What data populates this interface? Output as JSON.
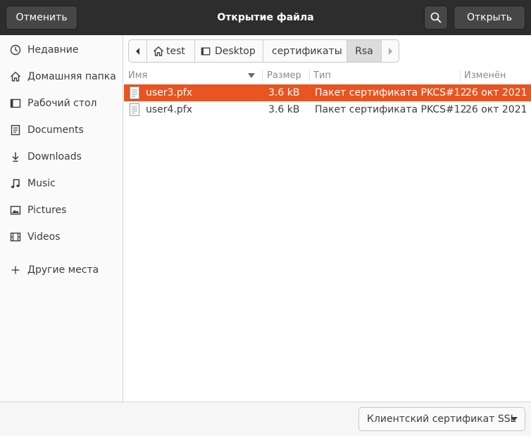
{
  "header": {
    "title": "Открытие файла",
    "cancel_label": "Отменить",
    "open_label": "Открыть",
    "search_icon": "search-icon"
  },
  "sidebar": {
    "items": [
      {
        "label": "Недавние",
        "icon": "clock-icon"
      },
      {
        "label": "Домашняя папка",
        "icon": "home-icon"
      },
      {
        "label": "Рабочий стол",
        "icon": "desktop-icon"
      },
      {
        "label": "Documents",
        "icon": "documents-icon"
      },
      {
        "label": "Downloads",
        "icon": "download-icon"
      },
      {
        "label": "Music",
        "icon": "music-icon"
      },
      {
        "label": "Pictures",
        "icon": "pictures-icon"
      },
      {
        "label": "Videos",
        "icon": "videos-icon"
      }
    ],
    "other_locations": {
      "label": "Другие места",
      "icon": "plus-icon"
    }
  },
  "pathbar": {
    "segments": [
      {
        "label": "test",
        "icon": "home-icon"
      },
      {
        "label": "Desktop",
        "icon": "desktop-icon"
      },
      {
        "label": "сертификаты"
      },
      {
        "label": "Rsa",
        "active": true
      }
    ]
  },
  "columns": {
    "name": "Имя",
    "size": "Размер",
    "type": "Тип",
    "modified": "Изменён"
  },
  "files": [
    {
      "name": "user3.pfx",
      "size": "3.6 kB",
      "type": "Пакет сертификата PKCS#12",
      "modified": "26 окт 2021",
      "selected": true
    },
    {
      "name": "user4.pfx",
      "size": "3.6 kB",
      "type": "Пакет сертификата PKCS#12",
      "modified": "26 окт 2021",
      "selected": false
    }
  ],
  "filter": {
    "selected": "Клиентский сертификат SSL"
  },
  "colors": {
    "accent": "#e95420",
    "headerbar": "#2d2d2d"
  }
}
